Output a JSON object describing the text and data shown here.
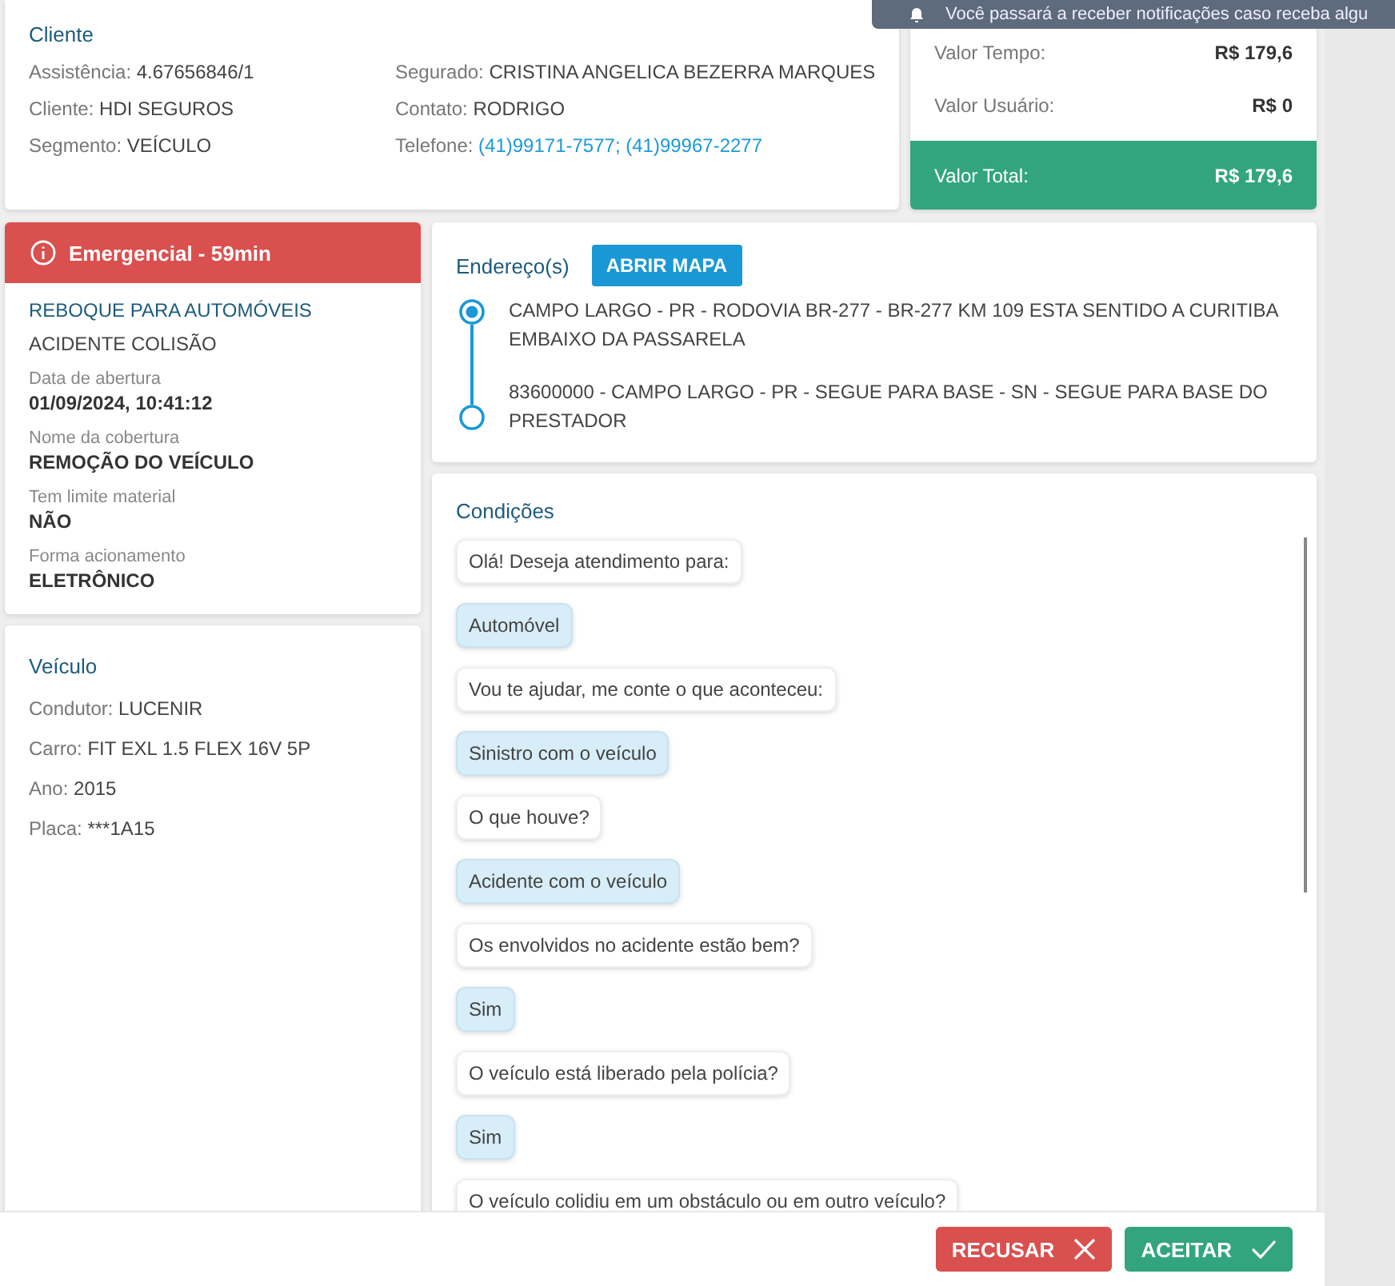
{
  "notification": {
    "text": "Você passará a receber notificações caso receba algu"
  },
  "client": {
    "title": "Cliente",
    "columns": [
      [
        {
          "label": "Assistência:",
          "value": "4.67656846/1",
          "kind": "text"
        },
        {
          "label": "Cliente:",
          "value": "HDI SEGUROS",
          "kind": "text"
        },
        {
          "label": "Segmento:",
          "value": "VEÍCULO",
          "kind": "text"
        }
      ],
      [
        {
          "label": "Segurado:",
          "value": "CRISTINA ANGELICA BEZERRA MARQUES",
          "kind": "text"
        },
        {
          "label": "Contato:",
          "value": "RODRIGO",
          "kind": "text"
        },
        {
          "label": "Telefone:",
          "value": "(41)99171-7577; (41)99967-2277",
          "kind": "link"
        }
      ]
    ]
  },
  "values": [
    {
      "label": "Valor Tempo:",
      "value": "R$ 179,6",
      "kind": "plain"
    },
    {
      "label": "Valor Usuário:",
      "value": "R$ 0",
      "kind": "plain"
    },
    {
      "label": "Valor Total:",
      "value": "R$ 179,6",
      "kind": "total"
    }
  ],
  "service": {
    "alert": "Emergencial - 59min",
    "name": "REBOQUE PARA AUTOMÓVEIS",
    "cause": "ACIDENTE COLISÃO",
    "details": [
      {
        "label": "Data de abertura",
        "value": "01/09/2024, 10:41:12"
      },
      {
        "label": "Nome da cobertura",
        "value": "REMOÇÃO DO VEÍCULO"
      },
      {
        "label": "Tem limite material",
        "value": "NÃO"
      },
      {
        "label": "Forma acionamento",
        "value": "ELETRÔNICO"
      }
    ]
  },
  "vehicle": {
    "title": "Veículo",
    "fields": [
      {
        "label": "Condutor:",
        "value": "LUCENIR"
      },
      {
        "label": "Carro:",
        "value": "FIT EXL 1.5 FLEX 16V 5P"
      },
      {
        "label": "Ano:",
        "value": "2015"
      },
      {
        "label": "Placa:",
        "value": "***1A15"
      }
    ]
  },
  "addresses": {
    "title": "Endereço(s)",
    "button": "ABRIR MAPA",
    "stops": [
      {
        "text": "CAMPO LARGO - PR - RODOVIA BR-277 - BR-277 KM 109 ESTA SENTIDO A CURITIBA EMBAIXO DA PASSARELA",
        "active": true
      },
      {
        "text": "83600000 - CAMPO LARGO - PR - SEGUE PARA BASE - SN - SEGUE PARA BASE DO PRESTADOR",
        "active": false
      }
    ]
  },
  "conditions": {
    "title": "Condições",
    "messages": [
      {
        "kind": "question",
        "text": "Olá! Deseja atendimento para:"
      },
      {
        "kind": "answer",
        "text": "Automóvel"
      },
      {
        "kind": "question",
        "text": "Vou te ajudar, me conte o que aconteceu:"
      },
      {
        "kind": "answer",
        "text": "Sinistro com o veículo"
      },
      {
        "kind": "question",
        "text": "O que houve?"
      },
      {
        "kind": "answer",
        "text": "Acidente com o veículo"
      },
      {
        "kind": "question",
        "text": "Os envolvidos no acidente estão bem?"
      },
      {
        "kind": "answer",
        "text": "Sim"
      },
      {
        "kind": "question",
        "text": "O veículo está liberado pela polícia?"
      },
      {
        "kind": "answer",
        "text": "Sim"
      },
      {
        "kind": "question",
        "text": "O veículo colidiu em um obstáculo ou em outro veículo?"
      }
    ]
  },
  "actions": [
    {
      "kind": "reject",
      "label": "RECUSAR"
    },
    {
      "kind": "accept",
      "label": "ACEITAR"
    }
  ]
}
